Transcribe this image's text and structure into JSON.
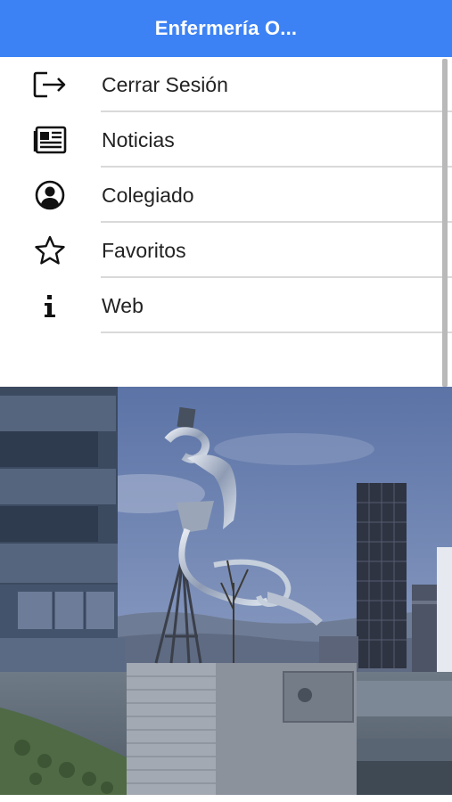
{
  "app_bar": {
    "title": "Enfermería O..."
  },
  "menu": {
    "items": [
      {
        "label": "Cerrar Sesión",
        "icon": "logout-icon"
      },
      {
        "label": "Noticias",
        "icon": "newspaper-icon"
      },
      {
        "label": "Colegiado",
        "icon": "account-circle-icon"
      },
      {
        "label": "Favoritos",
        "icon": "star-outline-icon"
      },
      {
        "label": "Web",
        "icon": "info-icon"
      }
    ]
  },
  "colors": {
    "app_bar": "#3d82f4",
    "divider": "#d9d9d9",
    "text": "#222222"
  },
  "hero": {
    "description_icon": "sculpture-photo"
  }
}
